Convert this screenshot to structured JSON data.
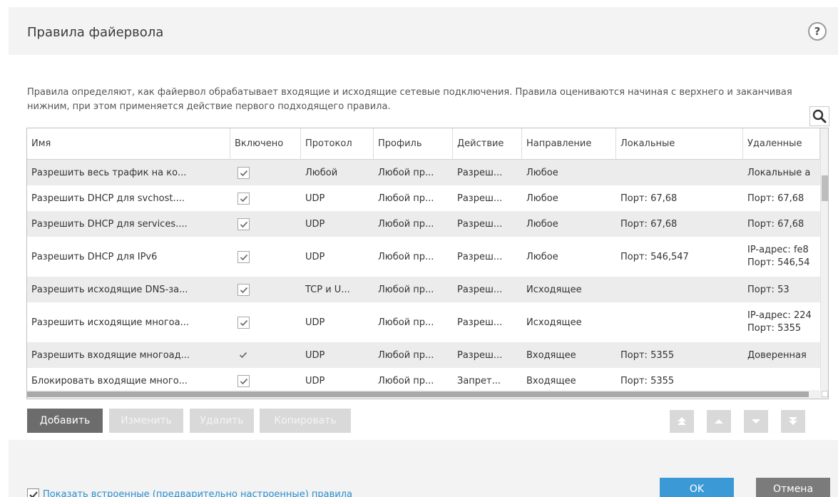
{
  "dialog": {
    "title": "Правила файервола",
    "help_label": "?",
    "description": "Правила определяют, как файервол обрабатывает входящие и исходящие сетевые подключения. Правила оцениваются начиная с верхнего и заканчивая нижним, при этом применяется действие первого подходящего правила."
  },
  "table": {
    "columns": [
      "Имя",
      "Включено",
      "Протокол",
      "Профиль",
      "Действие",
      "Направление",
      "Локальные",
      "Удаленные"
    ],
    "rows": [
      {
        "name": "Разрешить весь трафик на ко...",
        "enabled": true,
        "check_style": "box",
        "protocol": "Любой",
        "profile": "Любой пр...",
        "action": "Разреш...",
        "direction": "Любое",
        "local": "",
        "remote": "Локальные а"
      },
      {
        "name": "Разрешить DHCP для svchost....",
        "enabled": true,
        "check_style": "box",
        "protocol": "UDP",
        "profile": "Любой пр...",
        "action": "Разреш...",
        "direction": "Любое",
        "local": "Порт: 67,68",
        "remote": "Порт: 67,68"
      },
      {
        "name": "Разрешить DHCP для services....",
        "enabled": true,
        "check_style": "box",
        "protocol": "UDP",
        "profile": "Любой пр...",
        "action": "Разреш...",
        "direction": "Любое",
        "local": "Порт: 67,68",
        "remote": "Порт: 67,68"
      },
      {
        "name": "Разрешить DHCP для IPv6",
        "enabled": true,
        "check_style": "box",
        "protocol": "UDP",
        "profile": "Любой пр...",
        "action": "Разреш...",
        "direction": "Любое",
        "local": "Порт: 546,547",
        "remote": "IP-адрес: fe8\nПорт: 546,54"
      },
      {
        "name": "Разрешить исходящие DNS-за...",
        "enabled": true,
        "check_style": "box",
        "protocol": "TCP и U...",
        "profile": "Любой пр...",
        "action": "Разреш...",
        "direction": "Исходящее",
        "local": "",
        "remote": "Порт: 53"
      },
      {
        "name": "Разрешить исходящие многоа...",
        "enabled": true,
        "check_style": "box",
        "protocol": "UDP",
        "profile": "Любой пр...",
        "action": "Разреш...",
        "direction": "Исходящее",
        "local": "",
        "remote": "IP-адрес: 224\nПорт: 5355"
      },
      {
        "name": "Разрешить входящие многоад...",
        "enabled": true,
        "check_style": "plain",
        "protocol": "UDP",
        "profile": "Любой пр...",
        "action": "Разреш...",
        "direction": "Входящее",
        "local": "Порт: 5355",
        "remote": "Доверенная"
      },
      {
        "name": "Блокировать входящие много...",
        "enabled": true,
        "check_style": "box",
        "protocol": "UDP",
        "profile": "Любой пр...",
        "action": "Запрет...",
        "direction": "Входящее",
        "local": "Порт: 5355",
        "remote": ""
      }
    ]
  },
  "buttons": {
    "add": "Добавить",
    "edit": "Изменить",
    "delete": "Удалить",
    "copy": "Копировать"
  },
  "icons": {
    "search": "search-icon",
    "move_top": "move-top-icon",
    "move_up": "move-up-icon",
    "move_down": "move-down-icon",
    "move_bottom": "move-bottom-icon",
    "check": "checkmark-icon"
  },
  "footer": {
    "show_builtin_label": "Показать встроенные (предварительно настроенные) правила",
    "show_builtin_checked": true,
    "ok_label": "OK",
    "cancel_label": "Отмена"
  },
  "colors": {
    "accent": "#3b9ad6",
    "link": "#2b8fd0",
    "primary_button": "#6c6c6c",
    "disabled_button": "#d9d9d9",
    "cancel_button": "#7b7b7b"
  }
}
